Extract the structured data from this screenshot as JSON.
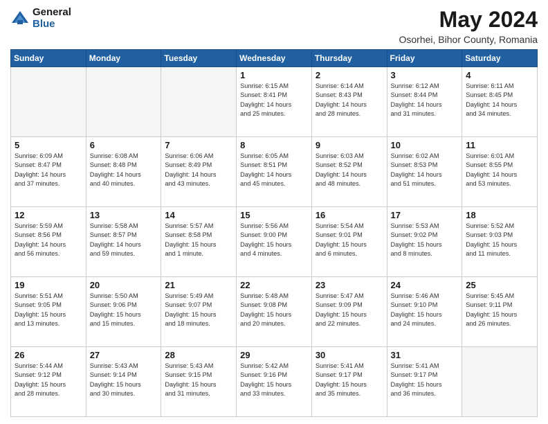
{
  "header": {
    "logo_general": "General",
    "logo_blue": "Blue",
    "title": "May 2024",
    "subtitle": "Osorhei, Bihor County, Romania"
  },
  "days_of_week": [
    "Sunday",
    "Monday",
    "Tuesday",
    "Wednesday",
    "Thursday",
    "Friday",
    "Saturday"
  ],
  "weeks": [
    [
      {
        "day": "",
        "info": ""
      },
      {
        "day": "",
        "info": ""
      },
      {
        "day": "",
        "info": ""
      },
      {
        "day": "1",
        "info": "Sunrise: 6:15 AM\nSunset: 8:41 PM\nDaylight: 14 hours\nand 25 minutes."
      },
      {
        "day": "2",
        "info": "Sunrise: 6:14 AM\nSunset: 8:43 PM\nDaylight: 14 hours\nand 28 minutes."
      },
      {
        "day": "3",
        "info": "Sunrise: 6:12 AM\nSunset: 8:44 PM\nDaylight: 14 hours\nand 31 minutes."
      },
      {
        "day": "4",
        "info": "Sunrise: 6:11 AM\nSunset: 8:45 PM\nDaylight: 14 hours\nand 34 minutes."
      }
    ],
    [
      {
        "day": "5",
        "info": "Sunrise: 6:09 AM\nSunset: 8:47 PM\nDaylight: 14 hours\nand 37 minutes."
      },
      {
        "day": "6",
        "info": "Sunrise: 6:08 AM\nSunset: 8:48 PM\nDaylight: 14 hours\nand 40 minutes."
      },
      {
        "day": "7",
        "info": "Sunrise: 6:06 AM\nSunset: 8:49 PM\nDaylight: 14 hours\nand 43 minutes."
      },
      {
        "day": "8",
        "info": "Sunrise: 6:05 AM\nSunset: 8:51 PM\nDaylight: 14 hours\nand 45 minutes."
      },
      {
        "day": "9",
        "info": "Sunrise: 6:03 AM\nSunset: 8:52 PM\nDaylight: 14 hours\nand 48 minutes."
      },
      {
        "day": "10",
        "info": "Sunrise: 6:02 AM\nSunset: 8:53 PM\nDaylight: 14 hours\nand 51 minutes."
      },
      {
        "day": "11",
        "info": "Sunrise: 6:01 AM\nSunset: 8:55 PM\nDaylight: 14 hours\nand 53 minutes."
      }
    ],
    [
      {
        "day": "12",
        "info": "Sunrise: 5:59 AM\nSunset: 8:56 PM\nDaylight: 14 hours\nand 56 minutes."
      },
      {
        "day": "13",
        "info": "Sunrise: 5:58 AM\nSunset: 8:57 PM\nDaylight: 14 hours\nand 59 minutes."
      },
      {
        "day": "14",
        "info": "Sunrise: 5:57 AM\nSunset: 8:58 PM\nDaylight: 15 hours\nand 1 minute."
      },
      {
        "day": "15",
        "info": "Sunrise: 5:56 AM\nSunset: 9:00 PM\nDaylight: 15 hours\nand 4 minutes."
      },
      {
        "day": "16",
        "info": "Sunrise: 5:54 AM\nSunset: 9:01 PM\nDaylight: 15 hours\nand 6 minutes."
      },
      {
        "day": "17",
        "info": "Sunrise: 5:53 AM\nSunset: 9:02 PM\nDaylight: 15 hours\nand 8 minutes."
      },
      {
        "day": "18",
        "info": "Sunrise: 5:52 AM\nSunset: 9:03 PM\nDaylight: 15 hours\nand 11 minutes."
      }
    ],
    [
      {
        "day": "19",
        "info": "Sunrise: 5:51 AM\nSunset: 9:05 PM\nDaylight: 15 hours\nand 13 minutes."
      },
      {
        "day": "20",
        "info": "Sunrise: 5:50 AM\nSunset: 9:06 PM\nDaylight: 15 hours\nand 15 minutes."
      },
      {
        "day": "21",
        "info": "Sunrise: 5:49 AM\nSunset: 9:07 PM\nDaylight: 15 hours\nand 18 minutes."
      },
      {
        "day": "22",
        "info": "Sunrise: 5:48 AM\nSunset: 9:08 PM\nDaylight: 15 hours\nand 20 minutes."
      },
      {
        "day": "23",
        "info": "Sunrise: 5:47 AM\nSunset: 9:09 PM\nDaylight: 15 hours\nand 22 minutes."
      },
      {
        "day": "24",
        "info": "Sunrise: 5:46 AM\nSunset: 9:10 PM\nDaylight: 15 hours\nand 24 minutes."
      },
      {
        "day": "25",
        "info": "Sunrise: 5:45 AM\nSunset: 9:11 PM\nDaylight: 15 hours\nand 26 minutes."
      }
    ],
    [
      {
        "day": "26",
        "info": "Sunrise: 5:44 AM\nSunset: 9:12 PM\nDaylight: 15 hours\nand 28 minutes."
      },
      {
        "day": "27",
        "info": "Sunrise: 5:43 AM\nSunset: 9:14 PM\nDaylight: 15 hours\nand 30 minutes."
      },
      {
        "day": "28",
        "info": "Sunrise: 5:43 AM\nSunset: 9:15 PM\nDaylight: 15 hours\nand 31 minutes."
      },
      {
        "day": "29",
        "info": "Sunrise: 5:42 AM\nSunset: 9:16 PM\nDaylight: 15 hours\nand 33 minutes."
      },
      {
        "day": "30",
        "info": "Sunrise: 5:41 AM\nSunset: 9:17 PM\nDaylight: 15 hours\nand 35 minutes."
      },
      {
        "day": "31",
        "info": "Sunrise: 5:41 AM\nSunset: 9:17 PM\nDaylight: 15 hours\nand 36 minutes."
      },
      {
        "day": "",
        "info": ""
      }
    ]
  ]
}
